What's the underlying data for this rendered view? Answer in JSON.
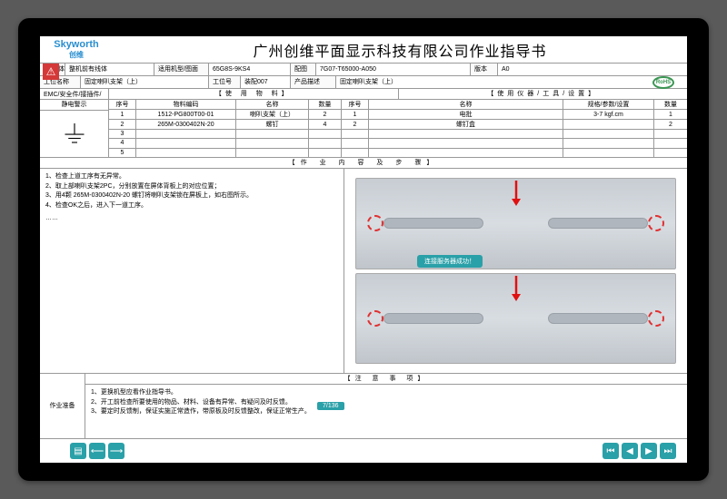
{
  "logo": {
    "en": "Skyworth",
    "cn": "创维"
  },
  "title": "广州创维平面显示科技有限公司作业指导书",
  "info_rows": [
    [
      {
        "label": "工/线体",
        "value": "整机前有线体"
      },
      {
        "label": "适用机型/图面",
        "value": "65G8S-9KS4"
      },
      {
        "label": "配图",
        "value": "7G07-T65000-A050"
      },
      {
        "label": "版本",
        "value": "A0"
      }
    ],
    [
      {
        "label": "工位名称",
        "value": "固定喇叭支架（上）"
      },
      {
        "label": "工位号",
        "value": "装配007"
      },
      {
        "label": "产品描述",
        "value": "固定喇叭支架（上）"
      },
      {
        "label": "",
        "value": ""
      }
    ]
  ],
  "emc_label": "EMC/安全件/接插件/",
  "esd_label": "静电警示",
  "dual_section": {
    "left": "【使 用 物 料】",
    "right": "【使用仪器/工具/设置】"
  },
  "rohs": "RoHS",
  "mat_header_left": [
    "序号",
    "物料编码",
    "名称",
    "数量"
  ],
  "mat_header_right": [
    "序号",
    "名称",
    "规格/参数/设置",
    "数量"
  ],
  "materials_left": [
    {
      "idx": "1",
      "code": "1512-PG800T00-01",
      "name": "喇叭支架（上）",
      "qty": "2"
    },
    {
      "idx": "2",
      "code": "265M-0300402N-20",
      "name": "螺钉",
      "qty": "4"
    },
    {
      "idx": "3",
      "code": "",
      "name": "",
      "qty": ""
    },
    {
      "idx": "4",
      "code": "",
      "name": "",
      "qty": ""
    },
    {
      "idx": "5",
      "code": "",
      "name": "",
      "qty": ""
    }
  ],
  "materials_right": [
    {
      "idx": "1",
      "name": "电批",
      "spec": "3-7 kgf.cm",
      "qty": "1"
    },
    {
      "idx": "2",
      "name": "螺钉盒",
      "spec": "",
      "qty": "2"
    },
    {
      "idx": "",
      "name": "",
      "spec": "",
      "qty": ""
    },
    {
      "idx": "",
      "name": "",
      "spec": "",
      "qty": ""
    },
    {
      "idx": "",
      "name": "",
      "spec": "",
      "qty": ""
    }
  ],
  "steps_title": "【作 业 内 容 及 步 骤】",
  "steps": [
    "1、检查上道工序有无异常。",
    "2、取上部喇叭支架2PC，分别放置在屏体背板上的对应位置；",
    "3、用4颗 265M-0300402N-20 螺钉将喇叭支架锁在屏板上，如右图所示。",
    "4、检查OK之后，进入下一道工序。"
  ],
  "spacer": "……",
  "notes_side": "作业准备",
  "notes_title": "【注 意 事 项】",
  "notes_lines": [
    "1、更换机型应看作业指导书。",
    "2、开工前检查所要使用的物品、材料、设备有异常、有疑问及时反馈。",
    "3、要定时反馈制，保证实施正常造作，带原板及时反馈整改，保证正常生产。"
  ],
  "toast": "连接服务器成功！",
  "page": "7/136",
  "nav_left": [
    "▤",
    "⟵",
    "⟶"
  ],
  "nav_right": [
    "⏮",
    "◀",
    "▶",
    "⏭"
  ]
}
